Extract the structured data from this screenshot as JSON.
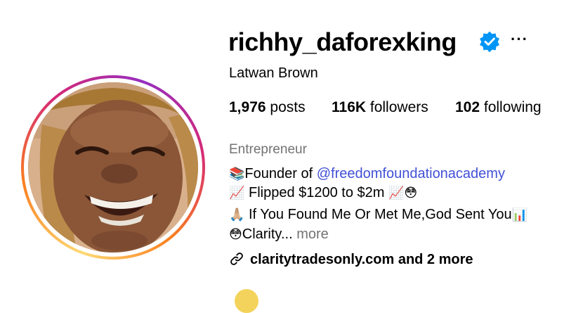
{
  "profile": {
    "username": "richhy_daforexking",
    "verified": true,
    "full_name": "Latwan Brown",
    "more_options_label": "···"
  },
  "stats": {
    "posts_count": "1,976",
    "posts_label": " posts",
    "followers_count": "116K",
    "followers_label": " followers",
    "following_count": "102",
    "following_label": " following"
  },
  "bio": {
    "category": "Entrepreneur",
    "line1_emoji": "📚",
    "line1_text": "Founder of ",
    "line1_mention": "@freedomfoundationacademy",
    "line2_emoji": "📈",
    "line2_text": " Flipped $1200 to $2m ",
    "line2_emoji_end": "📈😳",
    "line3_emoji": "🙏🏼",
    "line3_text": " If You Found Me Or Met Me,God Sent You",
    "line3_emoji_end": "📊",
    "line4_emoji": "😳",
    "line4_text": "Clarity... ",
    "more_label": "more"
  },
  "links": {
    "icon": "link-icon",
    "text": "claritytradesonly.com and 2 more"
  },
  "colors": {
    "verified_badge": "#0095f6",
    "mention": "#4150d6",
    "secondary_text": "#737373",
    "story_ring": [
      "#feda75",
      "#fa7e1e",
      "#d62976",
      "#962fbf"
    ]
  }
}
